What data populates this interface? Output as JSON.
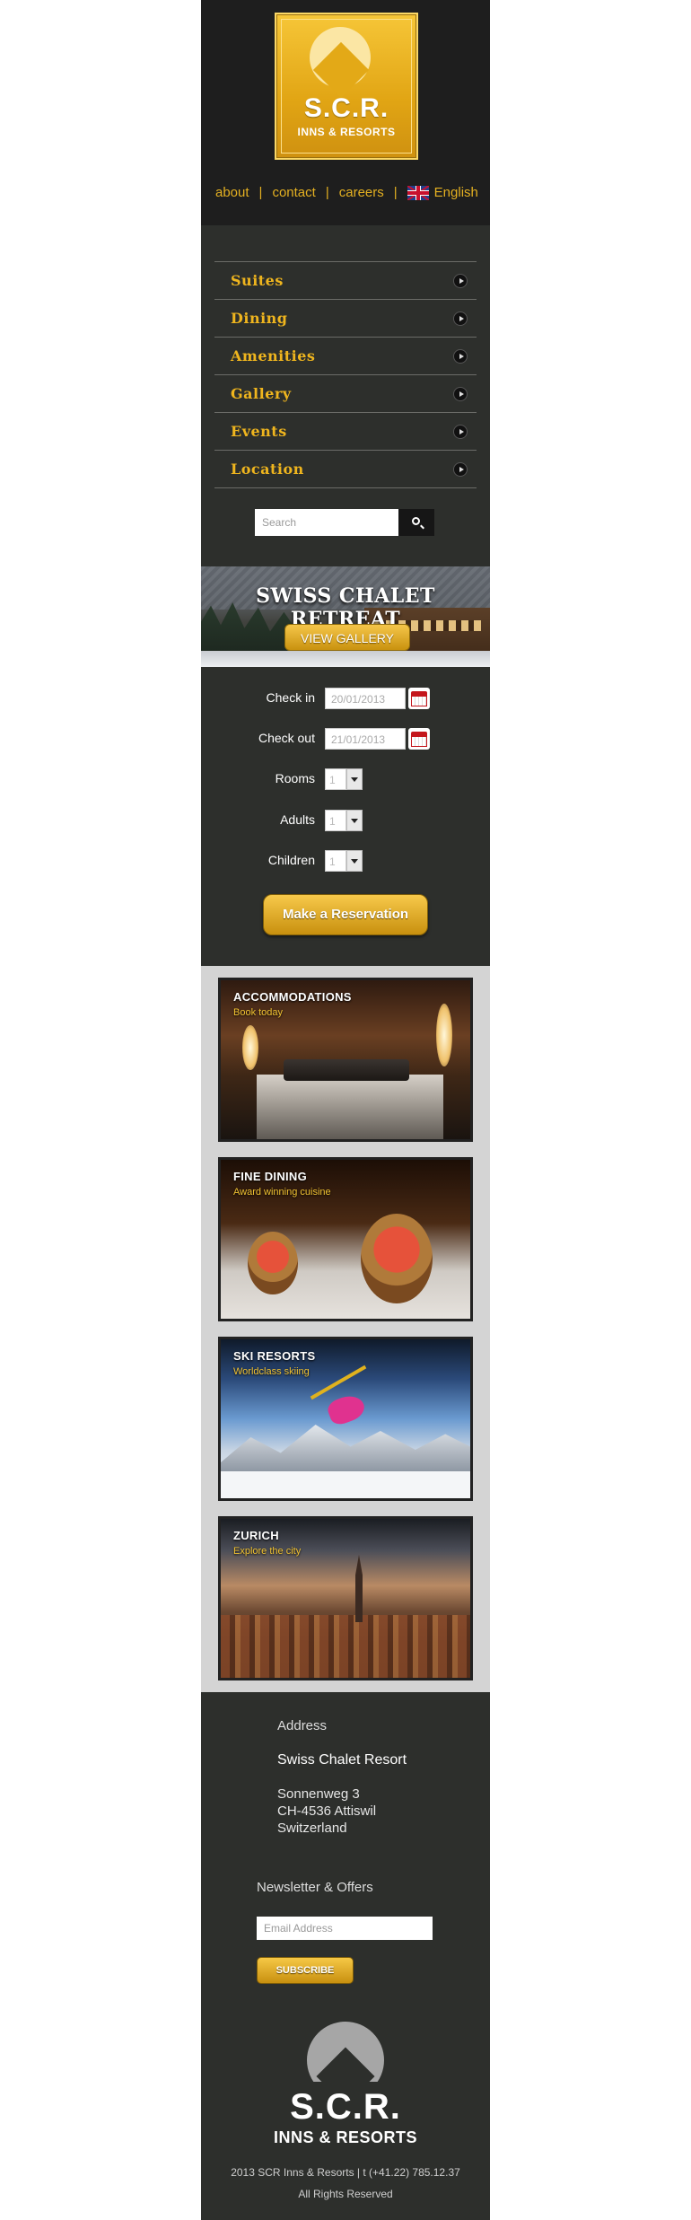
{
  "header": {
    "logo_title": "S.C.R.",
    "logo_subtitle": "INNS & RESORTS",
    "links": {
      "about": "about",
      "contact": "contact",
      "careers": "careers",
      "language": "English"
    },
    "separator": "|"
  },
  "menu": {
    "items": [
      {
        "label": "Suites"
      },
      {
        "label": "Dining"
      },
      {
        "label": "Amenities"
      },
      {
        "label": "Gallery"
      },
      {
        "label": "Events"
      },
      {
        "label": "Location"
      }
    ]
  },
  "search": {
    "placeholder": "Search"
  },
  "banner": {
    "title": "SWISS CHALET RETREAT",
    "button": "VIEW GALLERY"
  },
  "reservation": {
    "checkin_label": "Check in",
    "checkin_value": "20/01/2013",
    "checkout_label": "Check out",
    "checkout_value": "21/01/2013",
    "rooms_label": "Rooms",
    "rooms_value": "1",
    "adults_label": "Adults",
    "adults_value": "1",
    "children_label": "Children",
    "children_value": "1",
    "submit": "Make a Reservation"
  },
  "cards": [
    {
      "title": "ACCOMMODATIONS",
      "subtitle": "Book today"
    },
    {
      "title": "FINE DINING",
      "subtitle": "Award winning cuisine"
    },
    {
      "title": "SKI RESORTS",
      "subtitle": "Worldclass skiing"
    },
    {
      "title": "ZURICH",
      "subtitle": "Explore the city"
    }
  ],
  "footer": {
    "address_heading": "Address",
    "resort_name": "Swiss Chalet Resort",
    "street": "Sonnenweg 3",
    "city": "CH-4536 Attiswil",
    "country": "Switzerland",
    "newsletter_heading": "Newsletter & Offers",
    "email_placeholder": "Email Address",
    "subscribe": "SUBSCRIBE",
    "logo_title": "S.C.R.",
    "logo_subtitle": "INNS & RESORTS",
    "copyright": "2013 SCR Inns & Resorts  |  t (+41.22) 785.12.37",
    "rights": "All Rights Reserved"
  },
  "colors": {
    "accent": "#efb51e",
    "dark": "#2d2f2c",
    "header": "#1e1e1e"
  }
}
